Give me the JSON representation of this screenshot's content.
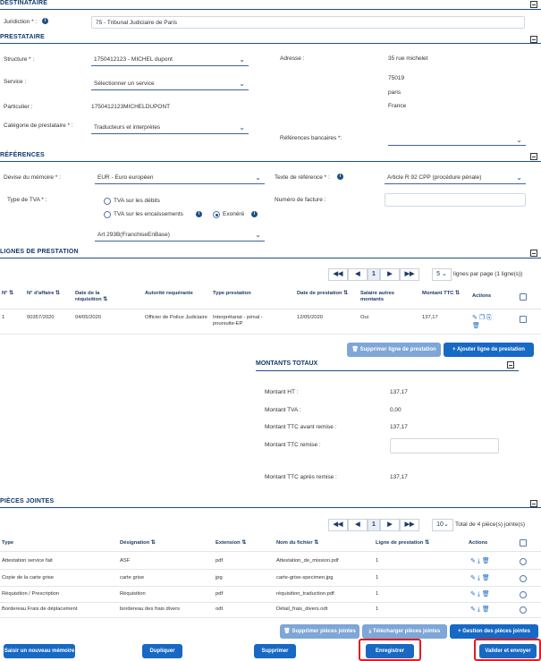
{
  "destinataire": {
    "title": "DESTINATAIRE",
    "juridiction_label": "Juridiction * :",
    "juridiction_value": "75 - Tribunal Judiciaire de Paris"
  },
  "prestataire": {
    "title": "PRESTATAIRE",
    "structure_label": "Structure * :",
    "structure_value": "1750412123 - MICHEL dupont",
    "service_label": "Service :",
    "service_value": "Sélectionner un service",
    "particulier_label": "Particulier :",
    "particulier_value": "1750412123MICHELDUPONT",
    "categorie_label": "Catégorie de prestataire * :",
    "categorie_value": "Traducteurs et interprètes",
    "adresse_label": "Adresse :",
    "adresse_line1": "35 rue michelet",
    "adresse_line2": "75019",
    "adresse_line3": "paris",
    "adresse_line4": "France",
    "ref_bancaires_label": "Références bancaires *:"
  },
  "references": {
    "title": "RÉFÉRENCES",
    "devise_label": "Devise du mémoire * :",
    "devise_value": "EUR - Euro européen",
    "texte_ref_label": "Texte de référence * :",
    "texte_ref_value": "Article R 92 CPP (procédure pénale)",
    "type_tva_label": "Type de TVA * :",
    "tva_debits": "TVA sur les débits",
    "tva_encaissements": "TVA sur les encaissements",
    "exonere": "Exonéré",
    "numero_facture_label": "Numéro de facture :",
    "article_value": "Art 293B(FranchiseEnBase)"
  },
  "lignes": {
    "title": "LIGNES DE PRESTATION",
    "pagination": {
      "first": "◀◀",
      "prev": "◀",
      "page": "1",
      "next": "▶",
      "last": "▶▶",
      "per_page": "5",
      "per_page_label": "lignes par page (1 ligne(s))"
    },
    "headers": [
      "N° ⇅",
      "N° d'affaire ⇅",
      "Date de la réquisition ⇅",
      "Autorité requérante",
      "Type prestation",
      "Date de prestation ⇅",
      "Salaire autres montants",
      "Montant TTC ⇅",
      "Actions"
    ],
    "rows": [
      [
        "1",
        "00357/2020",
        "04/05/2020",
        "Officier de Police Judiciaire",
        "Interprétariat - pénal - poursuite-EP",
        "12/05/2020",
        "Oui",
        "137,17"
      ]
    ],
    "btn_supprimer": "Supprimer ligne de prestation",
    "btn_ajouter": "Ajouter ligne de prestation"
  },
  "montants": {
    "title": "MONTANTS TOTAUX",
    "ht_label": "Montant HT :",
    "ht_value": "137,17",
    "tva_label": "Montant TVA :",
    "tva_value": "0,00",
    "ttc_avant_label": "Montant TTC avant remise :",
    "ttc_avant_value": "137,17",
    "ttc_remise_label": "Montant TTC remise :",
    "ttc_apres_label": "Montant TTC après remise :",
    "ttc_apres_value": "137,17"
  },
  "pieces": {
    "title": "PIÈCES JOINTES",
    "pagination": {
      "first": "◀◀",
      "prev": "◀",
      "page": "1",
      "next": "▶",
      "last": "▶▶",
      "per_page": "10",
      "total_label": "Total de 4 pièce(s) jointe(s)"
    },
    "headers": [
      "Type",
      "Désignation ⇅",
      "Extension ⇅",
      "Nom du fichier ⇅",
      "Ligne de prestation ⇅",
      "Actions"
    ],
    "rows": [
      [
        "Attestation service fait",
        "ASF",
        "pdf",
        "Attestation_de_mission.pdf",
        "1"
      ],
      [
        "Copie de la carte grise",
        "carte grise",
        "jpg",
        "carte-grise-specimen.jpg",
        "1"
      ],
      [
        "Réquisition / Prescription",
        "Réquisition",
        "pdf",
        "réquisition_traduction.pdf",
        "1"
      ],
      [
        "Bordereau Frais de déplacement",
        "bordereau des frais divers",
        "odt",
        "Détail_frais_divers.odt",
        "1"
      ]
    ],
    "btn_supprimer": "Supprimer pièces jointes",
    "btn_telecharger": "Télécharger pièces jointes",
    "btn_gestion": "Gestion des pièces jointes"
  },
  "footer": {
    "saisir": "Saisir un nouveau mémoire",
    "dupliquer": "Dupliquer",
    "supprimer": "Supprimer",
    "enregistrer": "Enregistrer",
    "valider": "Valider et envoyer"
  },
  "colors": {
    "primary": "#1769c4",
    "heading": "#0d3a6b",
    "highlight": "#e11b22"
  }
}
